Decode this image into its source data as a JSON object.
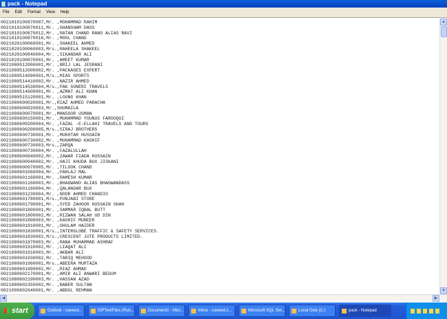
{
  "window": {
    "title": "pack - Notepad"
  },
  "menu": [
    "File",
    "Edit",
    "Format",
    "View",
    "Help"
  ],
  "lines": [
    "0021010100870007,Mr. ,MOHAMMAD RAHIM",
    "0021010100870011,Mr. ,GHANSHAM DASS",
    "0021010100870012,Mr. ,RATAN CHAND RANO ALIAS RAVI",
    "0021010100870016,Mr. ,MOOL CHAND",
    "0021020100060001,Mr. ,SHAKEEL AHMED",
    "0021020100060003,Mrs.,RAHEELA SHAKEEL",
    "0021020100840004,Mr. ,SIKANDAR ALI",
    "0021020100870001,Mr. ,AMEET KUMAR",
    "0021080512000001,Mr. ,BRIJ LAL JESRANI",
    "0021080512000002,Mr. ,PACKAGES EXPERT",
    "0021080514090001,M/s.,MIAS SPORTS",
    "0021080514410002,Mr. ,NAZIR AHMED",
    "0021080514530004,M/s.,PAK SONERI TRAVELS",
    "0021080514600001,Mr. ,AZMAT ALI KHAN",
    "0021080515120001,Mr. ,LOUNG KHAN",
    "0021080600020001,Mr.,RIAZ AHMED PARACHA",
    "0021080600020003,Mr.,SHUMAILA",
    "0021080600070001,Mr.,MANSOOR USMAN",
    "0021080600150001,Mr. ,MUHAMMAD YOUNUS FAROOQUI",
    "0021080600200004,Mr. ,FAZAL -E-ELLAHI TRAVELS AND TOURS",
    "0021080600200005,M/s.,SIRAJ BROTHERS",
    "0021080600730001,Mr. ,MUKHTAR HUSSAIN",
    "0021080600730002,Mr. ,MUHAMMAD KASHIF",
    "0021080600730003,Mrs.,ZARQA",
    "0021080600730004,Mr. ,FAZALULLAH",
    "0021080600840002,Mr. ,ZAWAR FIADA HUSSAIN",
    "0021080600940002,Mr. ,HAJI KHUDA BUX JISKANI",
    "0021080600970005,Mr. ,TILOOK CHAND",
    "0021080601060004,Mr. ,PAHLAJ MAL",
    "0021080601160001,Mr. ,RAMESH KUMAR",
    "0021080601160003,Mr. ,BHAGWANO ALIAS BHAGWANDASS",
    "0021080601160004,Mr. ,QALANDAR BUX",
    "0021080601230004,Mr. ,NOOR AHMED CHANDIO",
    "0021080601780001,M/s.,PUNJABI STORE",
    "0021080601790001,Mr. ,SYED ZAHOOR HUSSAIN SHAH",
    "0021080601800001,Mr. ,SAMMAR IQBAL BUTT",
    "0021080601800002,Mr. ,RIZWAN SALAH UD DIN",
    "0021080601800003,Mr. ,KASHIF MUNEER",
    "0021080601810001,Mr. ,GHULAM HAIDER",
    "0021080601830001,M/s.,INTERGLOBE TRAFFIC & SAFETY SERVICES.",
    "0021080601830002,M/s.,CRESCENT JUTE PRODUCTS LIMITED.",
    "0021080601870003,Mr. ,RANA MUHAMMAD ASHRAF",
    "0021080601910002,Mr. ,LIAQAT ALI",
    "0021080601910003,Mr. ,AKBAR ALI",
    "0021080601930002,Mr. ,TARIQ MEHOOD",
    "0021080601960001,Mrs.,ABEERA MURTAZA",
    "0021080601990002,Mr. ,RIAZ AHMAD",
    "0021080602170001,Mr. ,AMIR ALI ANWARI BEGUM",
    "0021080602190003,Mr. ,HASSAN AZAD",
    "0021080602350002,Mr. ,BABER SULTAN",
    "0021080602640001,Mr. ,ABDUL REHMAN"
  ],
  "taskbar": {
    "start": "start",
    "tasks": [
      "Outlook - naveed...",
      "ISPTextFiles (Run...",
      "Document1 - Micr...",
      "Inbox - naveed.z...",
      "Microsoft SQL Ser...",
      "Local Disk (C:)",
      "pack - Notepad"
    ]
  }
}
